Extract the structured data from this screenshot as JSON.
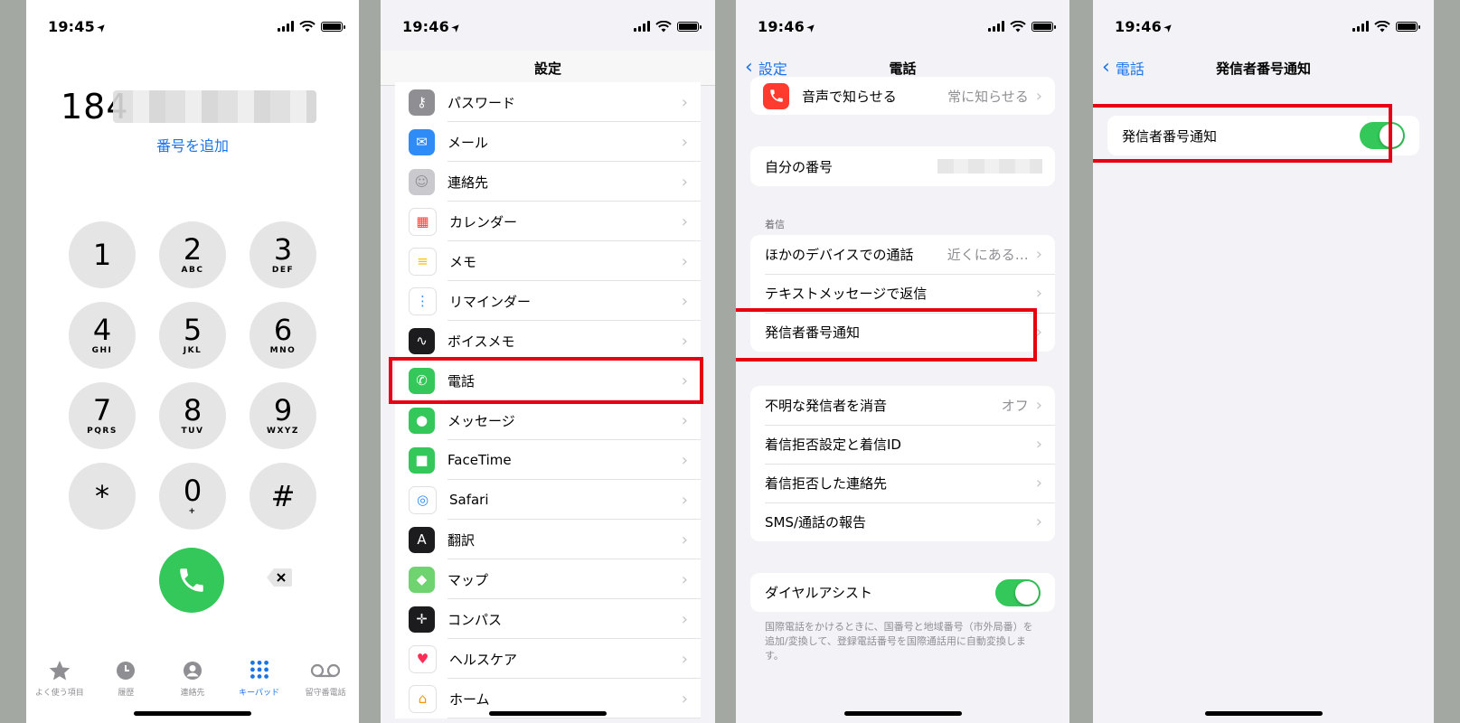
{
  "colors": {
    "accent": "#1a73e8",
    "green": "#34c759",
    "highlight": "#e60012"
  },
  "keypad_screen": {
    "time": "19:45",
    "dialed_number": "184",
    "add_number_link": "番号を追加",
    "keys": [
      {
        "digit": "1",
        "letters": ""
      },
      {
        "digit": "2",
        "letters": "ABC"
      },
      {
        "digit": "3",
        "letters": "DEF"
      },
      {
        "digit": "4",
        "letters": "GHI"
      },
      {
        "digit": "5",
        "letters": "JKL"
      },
      {
        "digit": "6",
        "letters": "MNO"
      },
      {
        "digit": "7",
        "letters": "PQRS"
      },
      {
        "digit": "8",
        "letters": "TUV"
      },
      {
        "digit": "9",
        "letters": "WXYZ"
      },
      {
        "digit": "*",
        "letters": ""
      },
      {
        "digit": "0",
        "letters": "+"
      },
      {
        "digit": "#",
        "letters": ""
      }
    ],
    "tabs": [
      {
        "label": "よく使う項目",
        "icon": "star-icon"
      },
      {
        "label": "履歴",
        "icon": "clock-icon"
      },
      {
        "label": "連絡先",
        "icon": "person-icon"
      },
      {
        "label": "キーパッド",
        "icon": "keypad-icon",
        "active": true
      },
      {
        "label": "留守番電話",
        "icon": "voicemail-icon"
      }
    ]
  },
  "settings_screen": {
    "time": "19:46",
    "title": "設定",
    "items": [
      {
        "label": "パスワード",
        "icon": "key-icon",
        "color": "#8e8e93"
      },
      {
        "label": "メール",
        "icon": "mail-icon",
        "color": "#2f8cf6"
      },
      {
        "label": "連絡先",
        "icon": "contacts-icon",
        "color": "#c9c9ce"
      },
      {
        "label": "カレンダー",
        "icon": "calendar-icon",
        "color": "#ffffff"
      },
      {
        "label": "メモ",
        "icon": "notes-icon",
        "color": "#ffffff"
      },
      {
        "label": "リマインダー",
        "icon": "reminders-icon",
        "color": "#ffffff"
      },
      {
        "label": "ボイスメモ",
        "icon": "voice-memo-icon",
        "color": "#1c1c1e"
      },
      {
        "label": "電話",
        "icon": "phone-icon",
        "color": "#34c759"
      },
      {
        "label": "メッセージ",
        "icon": "message-icon",
        "color": "#34c759"
      },
      {
        "label": "FaceTime",
        "icon": "facetime-icon",
        "color": "#34c759"
      },
      {
        "label": "Safari",
        "icon": "safari-icon",
        "color": "#ffffff"
      },
      {
        "label": "翻訳",
        "icon": "translate-icon",
        "color": "#1c1c1e"
      },
      {
        "label": "マップ",
        "icon": "maps-icon",
        "color": "#6fd36f"
      },
      {
        "label": "コンパス",
        "icon": "compass-icon",
        "color": "#1c1c1e"
      },
      {
        "label": "ヘルスケア",
        "icon": "health-icon",
        "color": "#ffffff"
      },
      {
        "label": "ホーム",
        "icon": "home-icon",
        "color": "#ffffff"
      }
    ]
  },
  "phone_screen": {
    "time": "19:46",
    "back_label": "設定",
    "title": "電話",
    "announce": {
      "label": "音声で知らせる",
      "value": "常に知らせる"
    },
    "my_number_label": "自分の番号",
    "incoming_header": "着信",
    "calls_group": [
      {
        "label": "ほかのデバイスでの通話",
        "value": "近くにある…"
      },
      {
        "label": "テキストメッセージで返信",
        "value": ""
      },
      {
        "label": "発信者番号通知",
        "value": ""
      }
    ],
    "block_group": [
      {
        "label": "不明な発信者を消音",
        "value": "オフ"
      },
      {
        "label": "着信拒否設定と着信ID",
        "value": ""
      },
      {
        "label": "着信拒否した連絡先",
        "value": ""
      },
      {
        "label": "SMS/通話の報告",
        "value": ""
      }
    ],
    "dial_assist_label": "ダイヤルアシスト",
    "dial_assist_on": true,
    "dial_assist_note": "国際電話をかけるときに、国番号と地域番号（市外局番）を追加/変換して、登録電話番号を国際通話用に自動変換します。"
  },
  "caller_id_screen": {
    "time": "19:46",
    "back_label": "電話",
    "title": "発信者番号通知",
    "toggle_label": "発信者番号通知",
    "toggle_on": true
  }
}
